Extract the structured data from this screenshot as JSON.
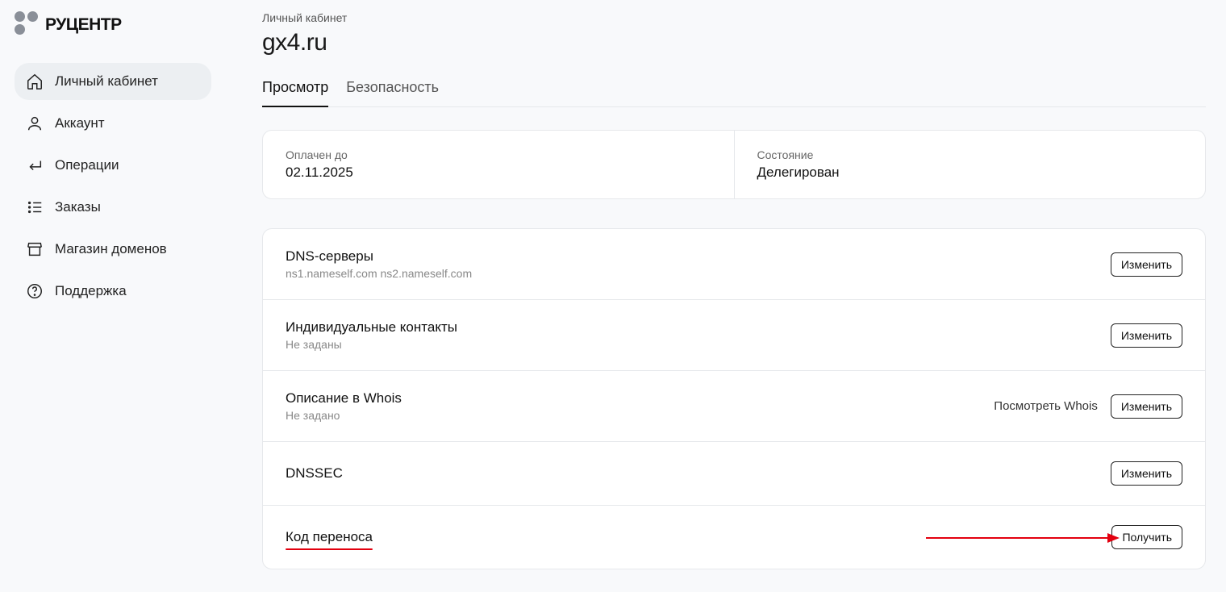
{
  "logo": {
    "text": "РУЦЕНТР"
  },
  "sidebar": {
    "items": [
      {
        "label": "Личный кабинет",
        "id": "dashboard",
        "active": true
      },
      {
        "label": "Аккаунт",
        "id": "account"
      },
      {
        "label": "Операции",
        "id": "operations"
      },
      {
        "label": "Заказы",
        "id": "orders"
      },
      {
        "label": "Магазин доменов",
        "id": "domain-store"
      },
      {
        "label": "Поддержка",
        "id": "support"
      }
    ]
  },
  "header": {
    "breadcrumb": "Личный кабинет",
    "title": "gx4.ru"
  },
  "tabs": [
    {
      "label": "Просмотр",
      "id": "view",
      "active": true
    },
    {
      "label": "Безопасность",
      "id": "security"
    }
  ],
  "info": {
    "paid_label": "Оплачен до",
    "paid_value": "02.11.2025",
    "status_label": "Состояние",
    "status_value": "Делегирован"
  },
  "rows": {
    "dns": {
      "title": "DNS-серверы",
      "sub": "ns1.nameself.com ns2.nameself.com",
      "action": "Изменить"
    },
    "contacts": {
      "title": "Индивидуальные контакты",
      "sub": "Не заданы",
      "action": "Изменить"
    },
    "whois": {
      "title": "Описание в Whois",
      "sub": "Не задано",
      "link": "Посмотреть Whois",
      "action": "Изменить"
    },
    "dnssec": {
      "title": "DNSSEC",
      "action": "Изменить"
    },
    "transfer": {
      "title": "Код переноса",
      "action": "Получить"
    }
  }
}
